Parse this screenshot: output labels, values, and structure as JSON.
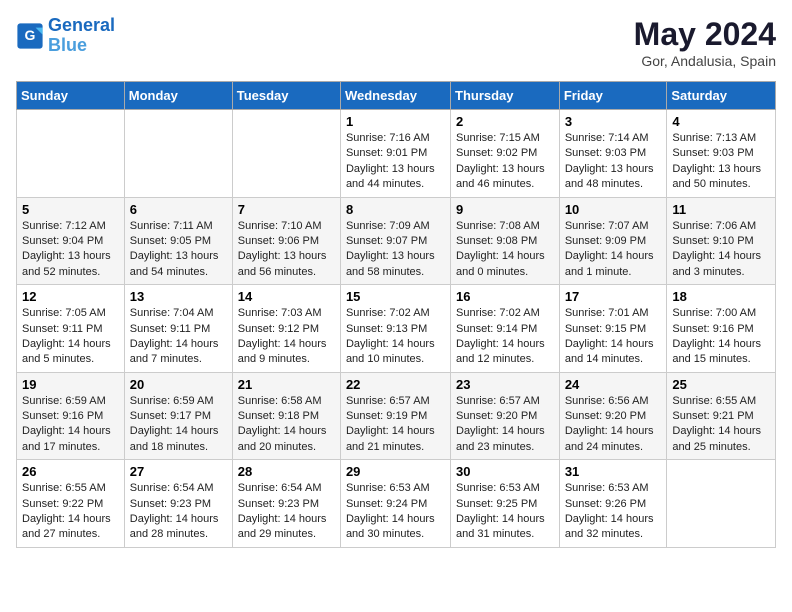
{
  "header": {
    "logo_line1": "General",
    "logo_line2": "Blue",
    "month_title": "May 2024",
    "location": "Gor, Andalusia, Spain"
  },
  "weekdays": [
    "Sunday",
    "Monday",
    "Tuesday",
    "Wednesday",
    "Thursday",
    "Friday",
    "Saturday"
  ],
  "weeks": [
    [
      {
        "day": "",
        "sunrise": "",
        "sunset": "",
        "daylight": ""
      },
      {
        "day": "",
        "sunrise": "",
        "sunset": "",
        "daylight": ""
      },
      {
        "day": "",
        "sunrise": "",
        "sunset": "",
        "daylight": ""
      },
      {
        "day": "1",
        "sunrise": "Sunrise: 7:16 AM",
        "sunset": "Sunset: 9:01 PM",
        "daylight": "Daylight: 13 hours and 44 minutes."
      },
      {
        "day": "2",
        "sunrise": "Sunrise: 7:15 AM",
        "sunset": "Sunset: 9:02 PM",
        "daylight": "Daylight: 13 hours and 46 minutes."
      },
      {
        "day": "3",
        "sunrise": "Sunrise: 7:14 AM",
        "sunset": "Sunset: 9:03 PM",
        "daylight": "Daylight: 13 hours and 48 minutes."
      },
      {
        "day": "4",
        "sunrise": "Sunrise: 7:13 AM",
        "sunset": "Sunset: 9:03 PM",
        "daylight": "Daylight: 13 hours and 50 minutes."
      }
    ],
    [
      {
        "day": "5",
        "sunrise": "Sunrise: 7:12 AM",
        "sunset": "Sunset: 9:04 PM",
        "daylight": "Daylight: 13 hours and 52 minutes."
      },
      {
        "day": "6",
        "sunrise": "Sunrise: 7:11 AM",
        "sunset": "Sunset: 9:05 PM",
        "daylight": "Daylight: 13 hours and 54 minutes."
      },
      {
        "day": "7",
        "sunrise": "Sunrise: 7:10 AM",
        "sunset": "Sunset: 9:06 PM",
        "daylight": "Daylight: 13 hours and 56 minutes."
      },
      {
        "day": "8",
        "sunrise": "Sunrise: 7:09 AM",
        "sunset": "Sunset: 9:07 PM",
        "daylight": "Daylight: 13 hours and 58 minutes."
      },
      {
        "day": "9",
        "sunrise": "Sunrise: 7:08 AM",
        "sunset": "Sunset: 9:08 PM",
        "daylight": "Daylight: 14 hours and 0 minutes."
      },
      {
        "day": "10",
        "sunrise": "Sunrise: 7:07 AM",
        "sunset": "Sunset: 9:09 PM",
        "daylight": "Daylight: 14 hours and 1 minute."
      },
      {
        "day": "11",
        "sunrise": "Sunrise: 7:06 AM",
        "sunset": "Sunset: 9:10 PM",
        "daylight": "Daylight: 14 hours and 3 minutes."
      }
    ],
    [
      {
        "day": "12",
        "sunrise": "Sunrise: 7:05 AM",
        "sunset": "Sunset: 9:11 PM",
        "daylight": "Daylight: 14 hours and 5 minutes."
      },
      {
        "day": "13",
        "sunrise": "Sunrise: 7:04 AM",
        "sunset": "Sunset: 9:11 PM",
        "daylight": "Daylight: 14 hours and 7 minutes."
      },
      {
        "day": "14",
        "sunrise": "Sunrise: 7:03 AM",
        "sunset": "Sunset: 9:12 PM",
        "daylight": "Daylight: 14 hours and 9 minutes."
      },
      {
        "day": "15",
        "sunrise": "Sunrise: 7:02 AM",
        "sunset": "Sunset: 9:13 PM",
        "daylight": "Daylight: 14 hours and 10 minutes."
      },
      {
        "day": "16",
        "sunrise": "Sunrise: 7:02 AM",
        "sunset": "Sunset: 9:14 PM",
        "daylight": "Daylight: 14 hours and 12 minutes."
      },
      {
        "day": "17",
        "sunrise": "Sunrise: 7:01 AM",
        "sunset": "Sunset: 9:15 PM",
        "daylight": "Daylight: 14 hours and 14 minutes."
      },
      {
        "day": "18",
        "sunrise": "Sunrise: 7:00 AM",
        "sunset": "Sunset: 9:16 PM",
        "daylight": "Daylight: 14 hours and 15 minutes."
      }
    ],
    [
      {
        "day": "19",
        "sunrise": "Sunrise: 6:59 AM",
        "sunset": "Sunset: 9:16 PM",
        "daylight": "Daylight: 14 hours and 17 minutes."
      },
      {
        "day": "20",
        "sunrise": "Sunrise: 6:59 AM",
        "sunset": "Sunset: 9:17 PM",
        "daylight": "Daylight: 14 hours and 18 minutes."
      },
      {
        "day": "21",
        "sunrise": "Sunrise: 6:58 AM",
        "sunset": "Sunset: 9:18 PM",
        "daylight": "Daylight: 14 hours and 20 minutes."
      },
      {
        "day": "22",
        "sunrise": "Sunrise: 6:57 AM",
        "sunset": "Sunset: 9:19 PM",
        "daylight": "Daylight: 14 hours and 21 minutes."
      },
      {
        "day": "23",
        "sunrise": "Sunrise: 6:57 AM",
        "sunset": "Sunset: 9:20 PM",
        "daylight": "Daylight: 14 hours and 23 minutes."
      },
      {
        "day": "24",
        "sunrise": "Sunrise: 6:56 AM",
        "sunset": "Sunset: 9:20 PM",
        "daylight": "Daylight: 14 hours and 24 minutes."
      },
      {
        "day": "25",
        "sunrise": "Sunrise: 6:55 AM",
        "sunset": "Sunset: 9:21 PM",
        "daylight": "Daylight: 14 hours and 25 minutes."
      }
    ],
    [
      {
        "day": "26",
        "sunrise": "Sunrise: 6:55 AM",
        "sunset": "Sunset: 9:22 PM",
        "daylight": "Daylight: 14 hours and 27 minutes."
      },
      {
        "day": "27",
        "sunrise": "Sunrise: 6:54 AM",
        "sunset": "Sunset: 9:23 PM",
        "daylight": "Daylight: 14 hours and 28 minutes."
      },
      {
        "day": "28",
        "sunrise": "Sunrise: 6:54 AM",
        "sunset": "Sunset: 9:23 PM",
        "daylight": "Daylight: 14 hours and 29 minutes."
      },
      {
        "day": "29",
        "sunrise": "Sunrise: 6:53 AM",
        "sunset": "Sunset: 9:24 PM",
        "daylight": "Daylight: 14 hours and 30 minutes."
      },
      {
        "day": "30",
        "sunrise": "Sunrise: 6:53 AM",
        "sunset": "Sunset: 9:25 PM",
        "daylight": "Daylight: 14 hours and 31 minutes."
      },
      {
        "day": "31",
        "sunrise": "Sunrise: 6:53 AM",
        "sunset": "Sunset: 9:26 PM",
        "daylight": "Daylight: 14 hours and 32 minutes."
      },
      {
        "day": "",
        "sunrise": "",
        "sunset": "",
        "daylight": ""
      }
    ]
  ]
}
